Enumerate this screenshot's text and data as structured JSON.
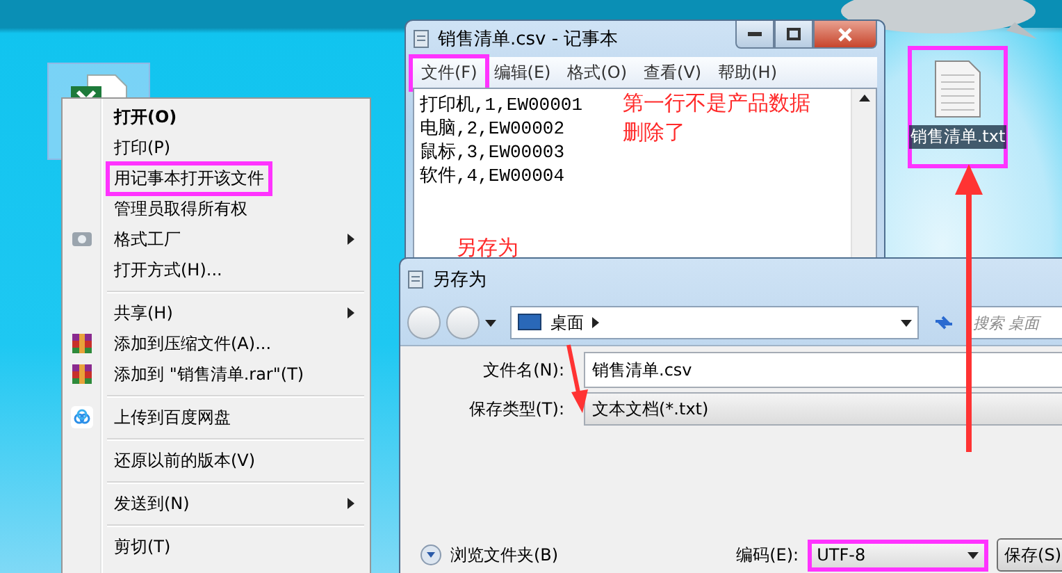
{
  "desktop_icons": [
    {
      "kind": "spreadsheet",
      "selected": true,
      "highlighted": false
    },
    {
      "kind": "text",
      "label": "销售清单.txt",
      "selected": false,
      "highlighted": true
    }
  ],
  "context_menu": {
    "items": [
      {
        "kind": "item",
        "label": "打开(O)",
        "bold": true,
        "highlighted": false,
        "submenu": false
      },
      {
        "kind": "item",
        "label": "打印(P)",
        "bold": false,
        "highlighted": false,
        "submenu": false
      },
      {
        "kind": "item",
        "label": "用记事本打开该文件",
        "bold": false,
        "highlighted": true,
        "submenu": false
      },
      {
        "kind": "item",
        "label": "管理员取得所有权",
        "bold": false,
        "highlighted": false,
        "submenu": false
      },
      {
        "kind": "item",
        "label": "格式工厂",
        "bold": false,
        "highlighted": false,
        "submenu": true
      },
      {
        "kind": "item",
        "label": "打开方式(H)...",
        "bold": false,
        "highlighted": false,
        "submenu": false
      },
      {
        "kind": "separator"
      },
      {
        "kind": "item",
        "label": "共享(H)",
        "bold": false,
        "highlighted": false,
        "submenu": true
      },
      {
        "kind": "item",
        "label": "添加到压缩文件(A)...",
        "bold": false,
        "highlighted": false,
        "submenu": false
      },
      {
        "kind": "item",
        "label": "添加到 \"销售清单.rar\"(T)",
        "bold": false,
        "highlighted": false,
        "submenu": false
      },
      {
        "kind": "separator"
      },
      {
        "kind": "item",
        "label": "上传到百度网盘",
        "bold": false,
        "highlighted": false,
        "submenu": false
      },
      {
        "kind": "separator"
      },
      {
        "kind": "item",
        "label": "还原以前的版本(V)",
        "bold": false,
        "highlighted": false,
        "submenu": false
      },
      {
        "kind": "separator"
      },
      {
        "kind": "item",
        "label": "发送到(N)",
        "bold": false,
        "highlighted": false,
        "submenu": true
      },
      {
        "kind": "separator"
      },
      {
        "kind": "item",
        "label": "剪切(T)",
        "bold": false,
        "highlighted": false,
        "submenu": false
      }
    ]
  },
  "notepad": {
    "title": "销售清单.csv - 记事本",
    "menu": [
      {
        "label": "文件(F)",
        "highlighted": true
      },
      {
        "label": "编辑(E)",
        "highlighted": false
      },
      {
        "label": "格式(O)",
        "highlighted": false
      },
      {
        "label": "查看(V)",
        "highlighted": false
      },
      {
        "label": "帮助(H)",
        "highlighted": false
      }
    ],
    "lines": [
      "打印机,1,EW00001",
      "电脑,2,EW00002",
      "鼠标,3,EW00003",
      "软件,4,EW00004"
    ]
  },
  "notes": {
    "lines": [
      "第一行不是产品数据",
      "删除了"
    ],
    "caption": "另存为"
  },
  "save_dialog": {
    "title": "另存为",
    "location": "桌面",
    "search_placeholder": "搜索 桌面",
    "file_name": {
      "label": "文件名(N):",
      "value": "销售清单.csv"
    },
    "save_type": {
      "label": "保存类型(T):",
      "value": "文本文档(*.txt)"
    },
    "browse": "浏览文件夹(B)",
    "encoding": {
      "label": "编码(E):",
      "value": "UTF-8",
      "highlighted": true
    },
    "save_button": "保存(S)"
  }
}
